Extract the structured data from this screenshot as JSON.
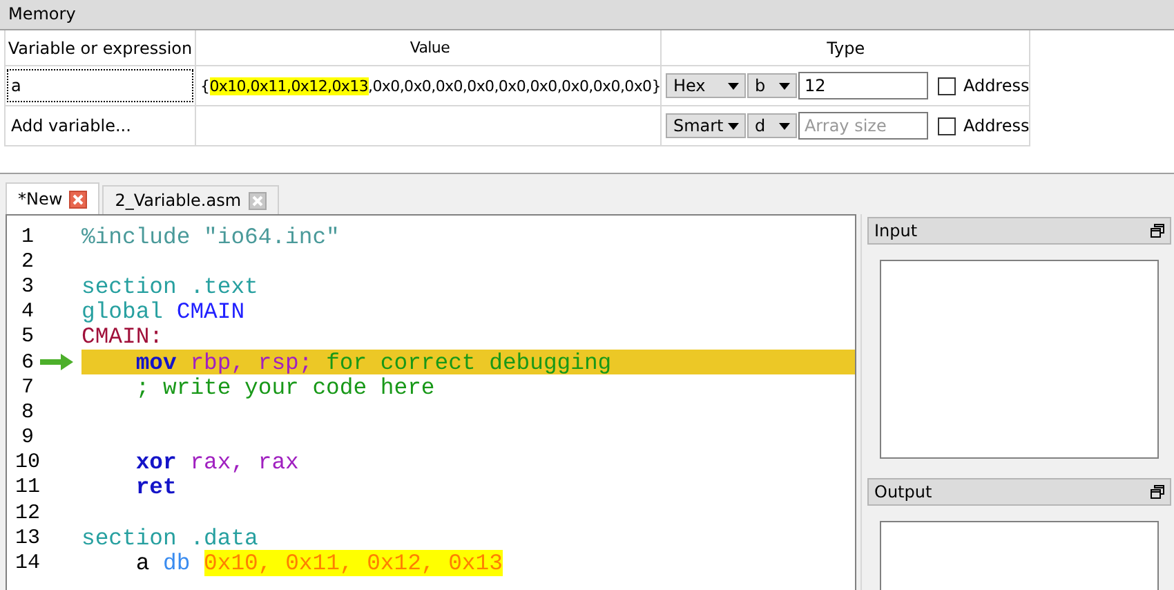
{
  "memory": {
    "title": "Memory",
    "columns": [
      "Variable or expression",
      "Value",
      "Type"
    ],
    "rows": [
      {
        "variable": "a",
        "selected": true,
        "value": [
          {
            "text": "{",
            "highlight": false
          },
          {
            "text": "0x10,0x11,0x12,0x13",
            "highlight": true
          },
          {
            "text": ",0x0,0x0,0x0,0x0,0x0,0x0,0x0,0x0,0x0}",
            "highlight": false
          }
        ],
        "format": "Hex",
        "size": "b",
        "count": "12",
        "address": {
          "label": "Address",
          "checked": false
        }
      },
      {
        "variable": "Add variable...",
        "selected": false,
        "format": "Smart",
        "size": "d",
        "count_placeholder": "Array size",
        "address": {
          "label": "Address",
          "checked": false
        }
      }
    ]
  },
  "tabs": [
    {
      "label": "*New",
      "selected": true
    },
    {
      "label": "2_Variable.asm",
      "selected": false
    }
  ],
  "code": [
    {
      "number": "1",
      "current": false,
      "tokens": [
        {
          "text": "%include \"io64.inc\"",
          "kind": "preprocessor"
        }
      ]
    },
    {
      "number": "2",
      "current": false
    },
    {
      "number": "3",
      "current": false,
      "tokens": [
        {
          "text": "section .text",
          "kind": "directive"
        }
      ]
    },
    {
      "number": "4",
      "current": false,
      "tokens": [
        {
          "text": "global ",
          "kind": "directive"
        },
        {
          "text": "CMAIN",
          "kind": "identifier"
        }
      ]
    },
    {
      "number": "5",
      "current": false,
      "tokens": [
        {
          "text": "CMAIN:",
          "kind": "label"
        }
      ]
    },
    {
      "number": "6",
      "current": true,
      "tokens": [
        {
          "text": "    mov",
          "kind": "instruction"
        },
        {
          "text": " rbp, rsp;",
          "kind": "register"
        },
        {
          "text": " for correct debugging",
          "kind": "comment"
        }
      ]
    },
    {
      "number": "7",
      "current": false,
      "tokens": [
        {
          "text": "    ; write your code here",
          "kind": "comment"
        }
      ]
    },
    {
      "number": "8",
      "current": false
    },
    {
      "number": "9",
      "current": false
    },
    {
      "number": "10",
      "current": false,
      "tokens": [
        {
          "text": "    xor",
          "kind": "instruction"
        },
        {
          "text": " rax, rax",
          "kind": "register"
        }
      ]
    },
    {
      "number": "11",
      "current": false,
      "tokens": [
        {
          "text": "    ret",
          "kind": "instruction"
        }
      ]
    },
    {
      "number": "12",
      "current": false
    },
    {
      "number": "13",
      "current": false,
      "tokens": [
        {
          "text": "section .data",
          "kind": "directive"
        }
      ]
    },
    {
      "number": "14",
      "current": false,
      "tokens": [
        {
          "text": "    a ",
          "kind": "plain"
        },
        {
          "text": "db ",
          "kind": "datatype"
        },
        {
          "text": "0x10, 0x11, 0x12, 0x13",
          "kind": "number",
          "highlight": true
        }
      ]
    }
  ],
  "panels": [
    {
      "title": "Input"
    },
    {
      "title": "Output"
    }
  ]
}
